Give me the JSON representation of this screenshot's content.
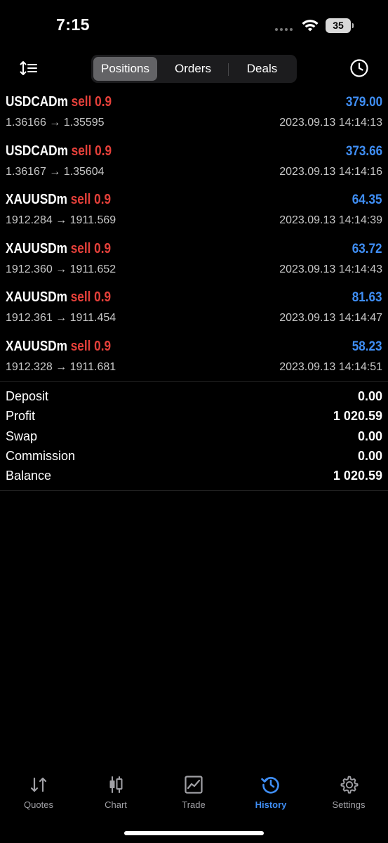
{
  "status_bar": {
    "time": "7:15",
    "battery": "35"
  },
  "toolbar": {
    "tabs": [
      {
        "label": "Positions",
        "active": true
      },
      {
        "label": "Orders",
        "active": false
      },
      {
        "label": "Deals",
        "active": false
      }
    ]
  },
  "positions": [
    {
      "symbol": "USDCADm",
      "side": "sell 0.9",
      "prices": "1.36166 → 1.35595",
      "profit": "379.00",
      "time": "2023.09.13 14:14:13"
    },
    {
      "symbol": "USDCADm",
      "side": "sell 0.9",
      "prices": "1.36167 → 1.35604",
      "profit": "373.66",
      "time": "2023.09.13 14:14:16"
    },
    {
      "symbol": "XAUUSDm",
      "side": "sell 0.9",
      "prices": "1912.284 → 1911.569",
      "profit": "64.35",
      "time": "2023.09.13 14:14:39"
    },
    {
      "symbol": "XAUUSDm",
      "side": "sell 0.9",
      "prices": "1912.360 → 1911.652",
      "profit": "63.72",
      "time": "2023.09.13 14:14:43"
    },
    {
      "symbol": "XAUUSDm",
      "side": "sell 0.9",
      "prices": "1912.361 → 1911.454",
      "profit": "81.63",
      "time": "2023.09.13 14:14:47"
    },
    {
      "symbol": "XAUUSDm",
      "side": "sell 0.9",
      "prices": "1912.328 → 1911.681",
      "profit": "58.23",
      "time": "2023.09.13 14:14:51"
    }
  ],
  "summary": [
    {
      "label": "Deposit",
      "value": "0.00"
    },
    {
      "label": "Profit",
      "value": "1 020.59"
    },
    {
      "label": "Swap",
      "value": "0.00"
    },
    {
      "label": "Commission",
      "value": "0.00"
    },
    {
      "label": "Balance",
      "value": "1 020.59"
    }
  ],
  "tab_bar": {
    "items": [
      {
        "label": "Quotes",
        "icon": "quotes-icon",
        "active": false
      },
      {
        "label": "Chart",
        "icon": "candlestick-icon",
        "active": false
      },
      {
        "label": "Trade",
        "icon": "trade-chart-icon",
        "active": false
      },
      {
        "label": "History",
        "icon": "history-icon",
        "active": true
      },
      {
        "label": "Settings",
        "icon": "gear-icon",
        "active": false
      }
    ]
  },
  "colors": {
    "background": "#000000",
    "sell": "#e5403a",
    "profit": "#3f8ef5",
    "accent": "#3f8ef5",
    "secondary_text": "#c7c7c7",
    "tab_inactive": "#a0a0a5"
  }
}
